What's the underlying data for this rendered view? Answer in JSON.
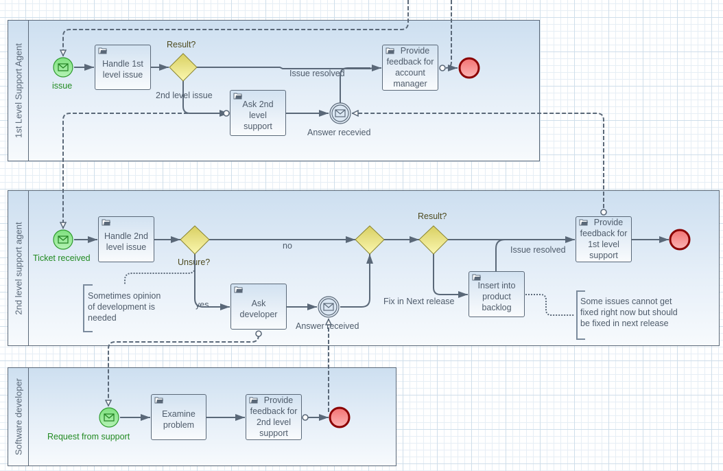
{
  "diagram": {
    "type": "BPMN collaboration",
    "colors": {
      "stroke": "#5a6878",
      "start_event_fill": "#8fe58f",
      "start_event_stroke": "#2e9b2e",
      "end_event_fill": "#f47f7f",
      "end_event_stroke": "#8b0000",
      "gateway_fill": "#e6e08a",
      "lane_fill_top": "#cddff0"
    }
  },
  "lanes": [
    {
      "title": "1st Level Support Agent",
      "start_event": {
        "label": "issue",
        "icon": "envelope-icon"
      },
      "tasks": [
        {
          "label": "Handle 1st\nlevel issue",
          "icon": "task-icon"
        },
        {
          "label": "Ask 2nd level\nsupport",
          "icon": "task-icon"
        },
        {
          "label": "Provide\nfeedback for\naccount\nmanager",
          "icon": "task-icon"
        }
      ],
      "gateway": {
        "label": "Result?"
      },
      "intermediate_event": {
        "label": "Answer recevied",
        "icon": "envelope-icon"
      },
      "flow_labels": {
        "resolved": "Issue resolved",
        "second_level": "2nd level issue"
      }
    },
    {
      "title": "2nd level support agent",
      "start_event": {
        "label": "Ticket received",
        "icon": "envelope-icon"
      },
      "tasks": [
        {
          "label": "Handle 2nd\nlevel issue",
          "icon": "task-icon"
        },
        {
          "label": "Ask\ndeveloper",
          "icon": "task-icon"
        },
        {
          "label": "Insert into\nproduct\nbacklog",
          "icon": "task-icon"
        },
        {
          "label": "Provide\nfeedback for\n1st level\nsupport",
          "icon": "task-icon"
        }
      ],
      "gateways": [
        {
          "label": "Unsure?"
        },
        {
          "label": ""
        },
        {
          "label": "Result?"
        }
      ],
      "intermediate_event": {
        "label": "Answer received",
        "icon": "envelope-icon"
      },
      "flow_labels": {
        "no": "no",
        "yes": "yes",
        "fix": "Fix in Next release",
        "resolved": "Issue resolved"
      },
      "annotations": [
        "Sometimes opinion\nof development is\nneeded",
        "Some issues cannot get\nfixed right now but should\nbe fixed in next release"
      ]
    },
    {
      "title": "Software developer",
      "start_event": {
        "label": "Request from support",
        "icon": "envelope-icon"
      },
      "tasks": [
        {
          "label": "Examine\nproblem",
          "icon": "task-icon"
        },
        {
          "label": "Provide\nfeedback for\n2nd level\nsupport",
          "icon": "task-icon"
        }
      ]
    }
  ]
}
